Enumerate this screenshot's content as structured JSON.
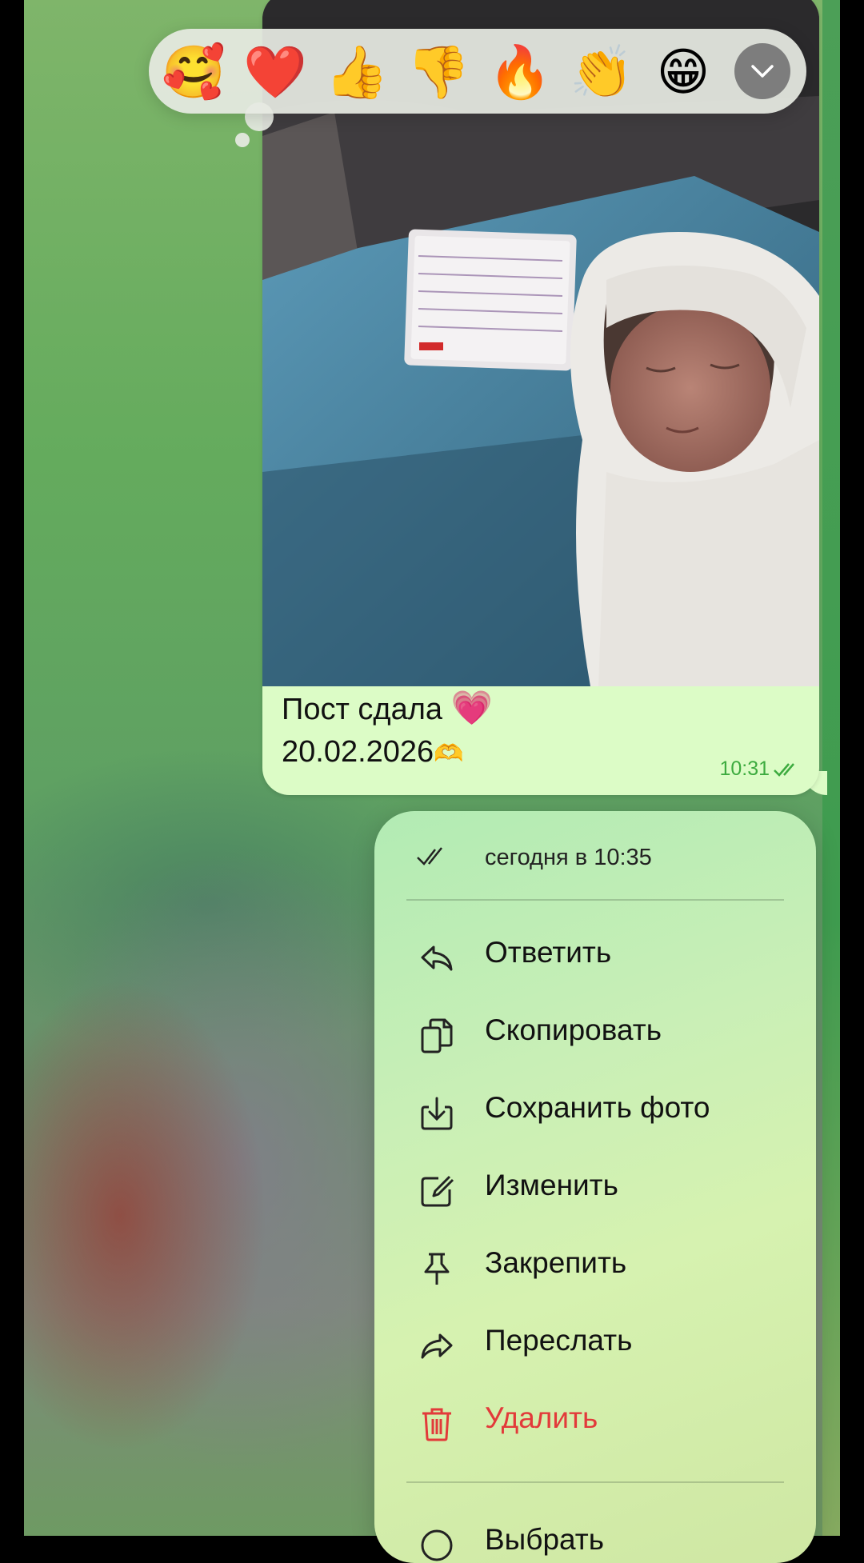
{
  "message": {
    "caption_line1": "Пост сдала",
    "caption_heart": "💗",
    "caption_line2": "20.02.2026",
    "caption_hands": "🫶",
    "time": "10:31",
    "status": "read"
  },
  "reactions": [
    "🥰",
    "❤️",
    "👍",
    "👎",
    "🔥",
    "👏",
    "😁"
  ],
  "context_menu": {
    "header": "сегодня в 10:35",
    "items": [
      {
        "label": "Ответить",
        "icon": "reply-icon"
      },
      {
        "label": "Скопировать",
        "icon": "copy-icon"
      },
      {
        "label": "Сохранить фото",
        "icon": "save-photo-icon"
      },
      {
        "label": "Изменить",
        "icon": "edit-icon"
      },
      {
        "label": "Закрепить",
        "icon": "pin-icon"
      },
      {
        "label": "Переслать",
        "icon": "forward-icon"
      },
      {
        "label": "Удалить",
        "icon": "trash-icon",
        "destructive": true
      }
    ],
    "partial_item": "Выбрать"
  },
  "colors": {
    "bubble": "#dcfcc6",
    "time_text": "#3dab3f",
    "destructive": "#e23a3a"
  }
}
